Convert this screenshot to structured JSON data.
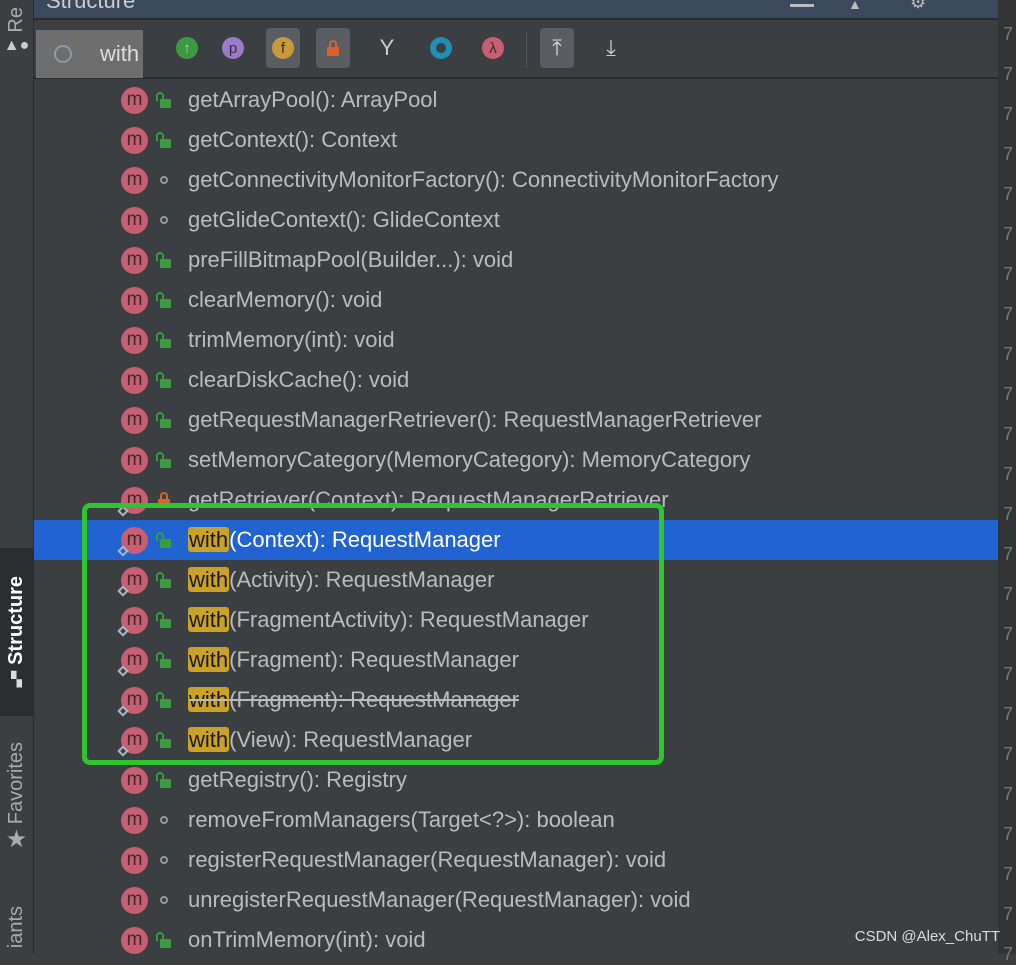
{
  "panel": {
    "title": "Structure"
  },
  "search": {
    "value": "with"
  },
  "sidebar": {
    "tabs": [
      {
        "label": "Re"
      },
      {
        "label": "Structure"
      },
      {
        "label": "Favorites"
      },
      {
        "label": "iants"
      }
    ]
  },
  "toolbar": {
    "icons": [
      "show-inherited-icon",
      "properties-icon",
      "fields-icon",
      "non-public-icon",
      "anonymous-classes-icon",
      "interfaces-icon",
      "lambdas-icon",
      "autoscroll-to-source-icon",
      "autoscroll-from-source-icon"
    ],
    "p": "p",
    "f": "f",
    "lambda": "λ"
  },
  "colors": {
    "selection": "#2163d1",
    "highlight": "#c9a227",
    "annotation_box": "#2ec52e",
    "method_icon": "#c75e72"
  },
  "tree": {
    "items": [
      {
        "name": "",
        "rest": "getArrayPool(): ArrayPool",
        "vis": "pub"
      },
      {
        "name": "",
        "rest": "getContext(): Context",
        "vis": "pub"
      },
      {
        "name": "",
        "rest": "getConnectivityMonitorFactory(): ConnectivityMonitorFactory",
        "vis": "pkg"
      },
      {
        "name": "",
        "rest": "getGlideContext(): GlideContext",
        "vis": "pkg"
      },
      {
        "name": "",
        "rest": "preFillBitmapPool(Builder...): void",
        "vis": "pub"
      },
      {
        "name": "",
        "rest": "clearMemory(): void",
        "vis": "pub"
      },
      {
        "name": "",
        "rest": "trimMemory(int): void",
        "vis": "pub"
      },
      {
        "name": "",
        "rest": "clearDiskCache(): void",
        "vis": "pub"
      },
      {
        "name": "",
        "rest": "getRequestManagerRetriever(): RequestManagerRetriever",
        "vis": "pub"
      },
      {
        "name": "",
        "rest": "setMemoryCategory(MemoryCategory): MemoryCategory",
        "vis": "pub"
      },
      {
        "name": "",
        "rest": "getRetriever(Context): RequestManagerRetriever",
        "vis": "priv",
        "static": true
      },
      {
        "name": "with",
        "rest": "(Context): RequestManager",
        "vis": "pub",
        "static": true,
        "selected": true
      },
      {
        "name": "with",
        "rest": "(Activity): RequestManager",
        "vis": "pub",
        "static": true
      },
      {
        "name": "with",
        "rest": "(FragmentActivity): RequestManager",
        "vis": "pub",
        "static": true
      },
      {
        "name": "with",
        "rest": "(Fragment): RequestManager",
        "vis": "pub",
        "static": true
      },
      {
        "name": "with",
        "rest": "(Fragment): RequestManager",
        "vis": "pub",
        "static": true,
        "deprecated": true
      },
      {
        "name": "with",
        "rest": "(View): RequestManager",
        "vis": "pub",
        "static": true
      },
      {
        "name": "",
        "rest": "getRegistry(): Registry",
        "vis": "pub"
      },
      {
        "name": "",
        "rest": "removeFromManagers(Target<?>): boolean",
        "vis": "pkg"
      },
      {
        "name": "",
        "rest": "registerRequestManager(RequestManager): void",
        "vis": "pkg"
      },
      {
        "name": "",
        "rest": "unregisterRequestManager(RequestManager): void",
        "vis": "pkg"
      },
      {
        "name": "",
        "rest": "onTrimMemory(int): void",
        "vis": "pub"
      }
    ],
    "method_letter": "m"
  },
  "watermark": "CSDN @Alex_ChuTT"
}
